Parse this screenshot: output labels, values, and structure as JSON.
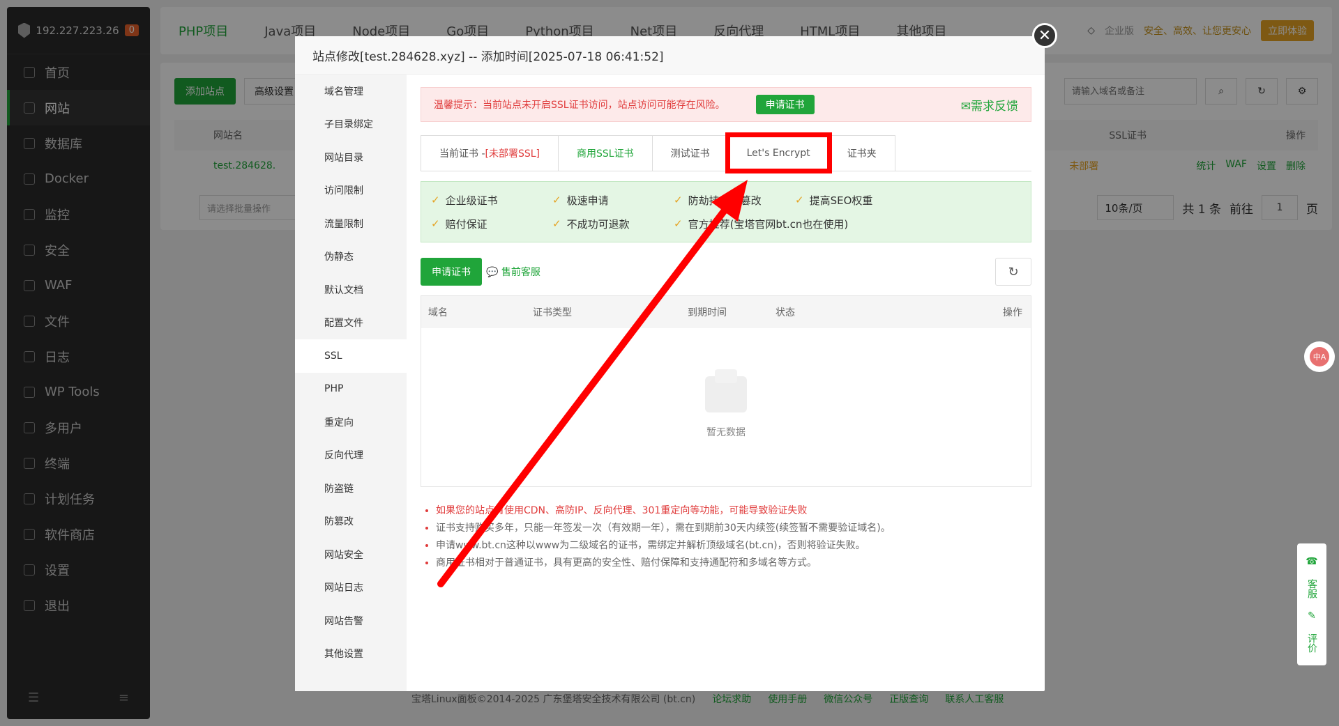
{
  "sidebar": {
    "ip": "192.227.223.26",
    "badge": "0",
    "items": [
      {
        "label": "首页"
      },
      {
        "label": "网站"
      },
      {
        "label": "数据库"
      },
      {
        "label": "Docker"
      },
      {
        "label": "监控"
      },
      {
        "label": "安全"
      },
      {
        "label": "WAF"
      },
      {
        "label": "文件"
      },
      {
        "label": "日志"
      },
      {
        "label": "WP Tools"
      },
      {
        "label": "多用户"
      },
      {
        "label": "终端"
      },
      {
        "label": "计划任务"
      },
      {
        "label": "软件商店"
      },
      {
        "label": "设置"
      },
      {
        "label": "退出"
      }
    ]
  },
  "topbar": {
    "tabs": [
      "PHP项目",
      "Java项目",
      "Node项目",
      "Go项目",
      "Python项目",
      "Net项目",
      "反向代理",
      "HTML项目",
      "其他项目"
    ],
    "edition": "企业版",
    "slogan": "安全、高效、让您更安心",
    "try_label": "立即体验"
  },
  "bg": {
    "add_site": "添加站点",
    "advanced": "高级设置",
    "search_placeholder": "请输入域名或备注",
    "col_site": "网站名",
    "col_ssl": "SSL证书",
    "col_ops": "操作",
    "site_name": "test.284628.",
    "ssl_status": "未部署",
    "ops": [
      "统计",
      "WAF",
      "设置",
      "删除"
    ],
    "batch_placeholder": "请选择批量操作",
    "page_size": "10条/页",
    "total": "共 1 条",
    "goto": "前往",
    "page": "1",
    "page_suffix": "页"
  },
  "modal": {
    "title": "站点修改[test.284628.xyz] -- 添加时间[2025-07-18 06:41:52]",
    "menu": [
      "域名管理",
      "子目录绑定",
      "网站目录",
      "访问限制",
      "流量限制",
      "伪静态",
      "默认文档",
      "配置文件",
      "SSL",
      "PHP",
      "重定向",
      "反向代理",
      "防盗链",
      "防篡改",
      "网站安全",
      "网站日志",
      "网站告警",
      "其他设置"
    ],
    "warning": {
      "text": "温馨提示：当前站点未开启SSL证书访问，站点访问可能存在风险。",
      "apply": "申请证书",
      "feedback": "需求反馈"
    },
    "tabs": {
      "current": "当前证书 - ",
      "current_status": "[未部署SSL]",
      "commercial": "商用SSL证书",
      "test": "测试证书",
      "letsencrypt": "Let's Encrypt",
      "folder": "证书夹"
    },
    "features": [
      "企业级证书",
      "极速申请",
      "防劫持、防篡改",
      "提高SEO权重",
      "赔付保证",
      "不成功可退款",
      "官方推荐(宝塔官网bt.cn也在使用)"
    ],
    "apply_btn": "申请证书",
    "presale": "售前客服",
    "table": {
      "columns": [
        "域名",
        "证书类型",
        "到期时间",
        "状态",
        "操作"
      ],
      "empty": "暂无数据"
    },
    "notes": [
      "如果您的站点有使用CDN、高防IP、反向代理、301重定向等功能，可能导致验证失败",
      "证书支持购买多年，只能一年签发一次（有效期一年），需在到期前30天内续签(续签暂不需要验证域名)。",
      "申请www.bt.cn这种以www为二级域名的证书，需绑定并解析顶级域名(bt.cn)，否则将验证失败。",
      "商用证书相对于普通证书，具有更高的安全性、赔付保障和支持通配符和多域名等方式。"
    ]
  },
  "footer": {
    "copyright": "宝塔Linux面板©2014-2025 广东堡塔安全技术有限公司 (bt.cn)",
    "links": [
      "论坛求助",
      "使用手册",
      "微信公众号",
      "正版查询",
      "联系人工客服"
    ]
  },
  "float": {
    "service": "客服",
    "review": "评价",
    "translate": "中A"
  },
  "colors": {
    "brand": "#20a53a",
    "warning": "#e03b3b",
    "annotation": "#ff0000"
  }
}
